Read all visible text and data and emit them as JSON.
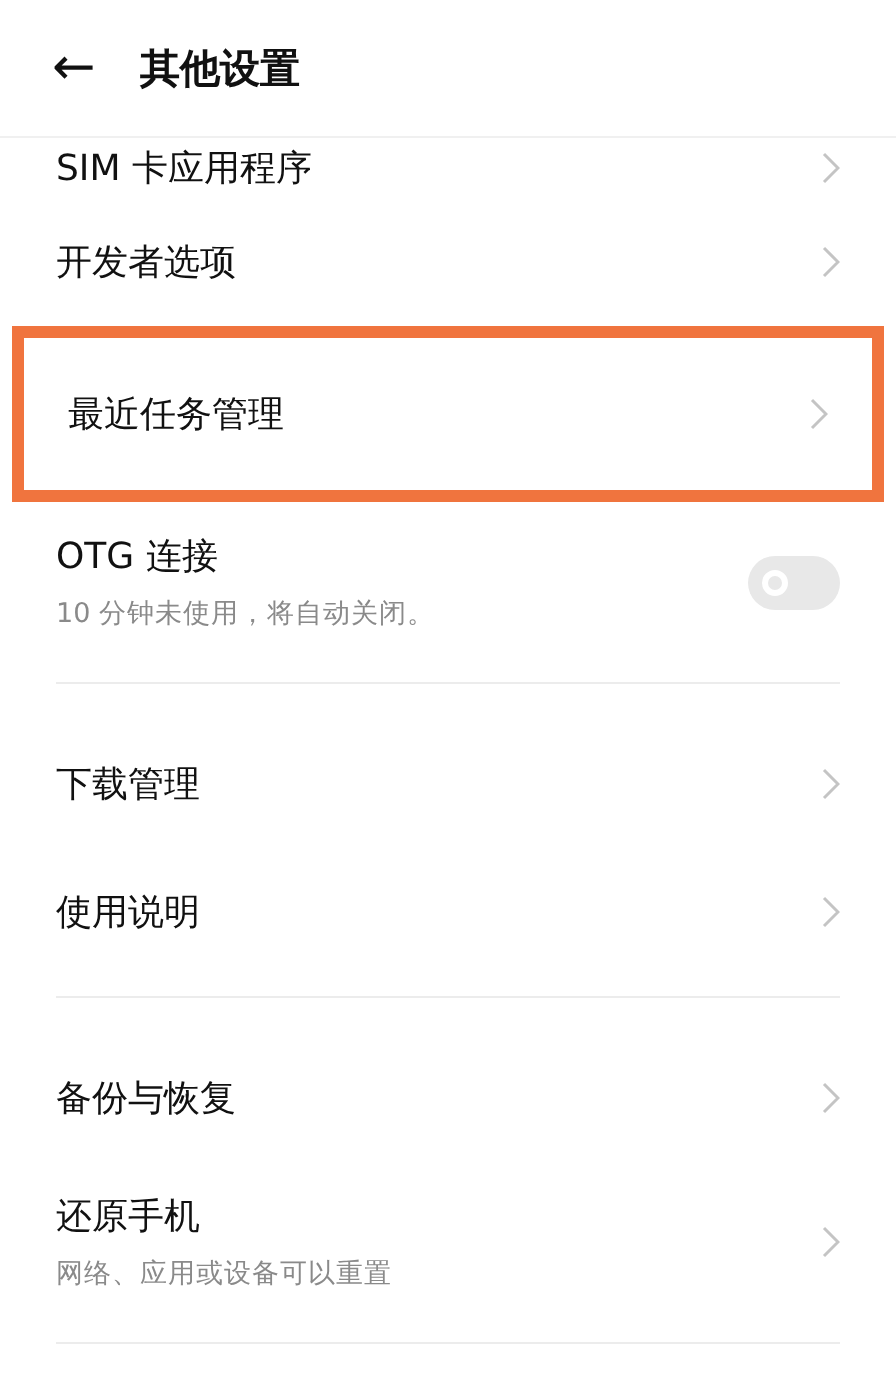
{
  "header": {
    "back": "←",
    "title": "其他设置"
  },
  "items": [
    {
      "kind": "link",
      "label": "SIM 卡应用程序",
      "highlighted": false,
      "cut": true
    },
    {
      "kind": "link",
      "label": "开发者选项",
      "highlighted": false
    },
    {
      "kind": "link",
      "label": "最近任务管理",
      "highlighted": true
    },
    {
      "kind": "switch",
      "label": "OTG 连接",
      "subtitle": "10 分钟未使用，将自动关闭。",
      "on": false
    },
    {
      "kind": "divider"
    },
    {
      "kind": "link",
      "label": "下载管理",
      "highlighted": false
    },
    {
      "kind": "link",
      "label": "使用说明",
      "highlighted": false
    },
    {
      "kind": "divider"
    },
    {
      "kind": "link",
      "label": "备份与恢复",
      "highlighted": false
    },
    {
      "kind": "link",
      "label": "还原手机",
      "subtitle": "网络、应用或设备可以重置",
      "highlighted": false
    },
    {
      "kind": "divider"
    }
  ]
}
